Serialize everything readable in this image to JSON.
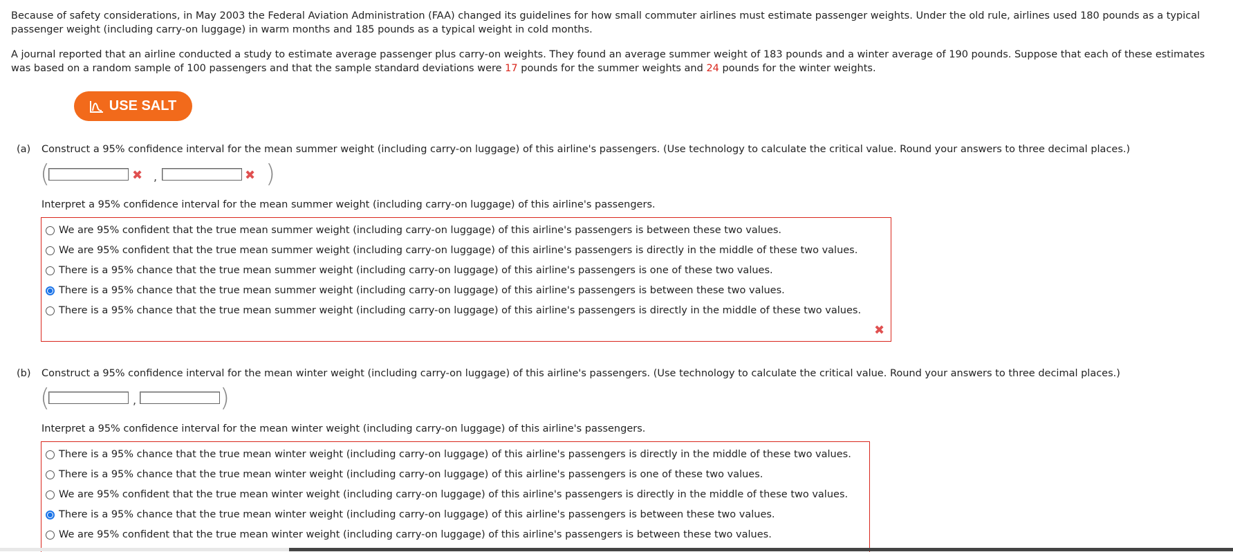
{
  "intro": {
    "p1": "Because of safety considerations, in May 2003 the Federal Aviation Administration (FAA) changed its guidelines for how small commuter airlines must estimate passenger weights. Under the old rule, airlines used 180 pounds as a typical passenger weight (including carry-on luggage) in warm months and 185 pounds as a typical weight in cold months.",
    "p2_a": "A journal reported that an airline conducted a study to estimate average passenger plus carry-on weights. They found an average summer weight of 183 pounds and a winter average of 190 pounds. Suppose that each of these estimates was based on a random sample of 100 passengers and that the sample standard deviations were ",
    "sd_summer": "17",
    "p2_b": " pounds for the summer weights and ",
    "sd_winter": "24",
    "p2_c": " pounds for the winter weights."
  },
  "salt_button": {
    "label": "USE SALT",
    "icon": "salt-chart-icon"
  },
  "part_a": {
    "label": "(a)",
    "question": "Construct a 95% confidence interval for the mean summer weight (including carry-on luggage) of this airline's passengers. (Use technology to calculate the critical value. Round your answers to three decimal places.)",
    "lower_value": "",
    "upper_value": "",
    "open_paren": "(",
    "close_paren": ")",
    "comma": ",",
    "incorrect_mark": "✖",
    "interpret_prompt": "Interpret a 95% confidence interval for the mean summer weight (including carry-on luggage) of this airline's passengers.",
    "options": [
      "We are 95% confident that the true mean summer weight (including carry-on luggage) of this airline's passengers is between these two values.",
      "We are 95% confident that the true mean summer weight (including carry-on luggage) of this airline's passengers is directly in the middle of these two values.",
      "There is a 95% chance that the true mean summer weight (including carry-on luggage) of this airline's passengers is one of these two values.",
      "There is a 95% chance that the true mean summer weight (including carry-on luggage) of this airline's passengers is between these two values.",
      "There is a 95% chance that the true mean summer weight (including carry-on luggage) of this airline's passengers is directly in the middle of these two values."
    ],
    "selected_index": 3
  },
  "part_b": {
    "label": "(b)",
    "question": "Construct a 95% confidence interval for the mean winter weight (including carry-on luggage) of this airline's passengers. (Use technology to calculate the critical value. Round your answers to three decimal places.)",
    "lower_value": "",
    "upper_value": "",
    "open_paren": "(",
    "close_paren": ")",
    "comma": ",",
    "interpret_prompt": "Interpret a 95% confidence interval for the mean winter weight (including carry-on luggage) of this airline's passengers.",
    "options": [
      "There is a 95% chance that the true mean winter weight (including carry-on luggage) of this airline's passengers is directly in the middle of these two values.",
      "There is a 95% chance that the true mean winter weight (including carry-on luggage) of this airline's passengers is one of these two values.",
      "We are 95% confident that the true mean winter weight (including carry-on luggage) of this airline's passengers is directly in the middle of these two values.",
      "There is a 95% chance that the true mean winter weight (including carry-on luggage) of this airline's passengers is between these two values.",
      "We are 95% confident that the true mean winter weight (including carry-on luggage) of this airline's passengers is between these two values."
    ],
    "selected_index": 3
  },
  "colors": {
    "accent_orange": "#f26a1b",
    "error_red": "#d9261c",
    "radio_blue": "#1a73e8"
  }
}
